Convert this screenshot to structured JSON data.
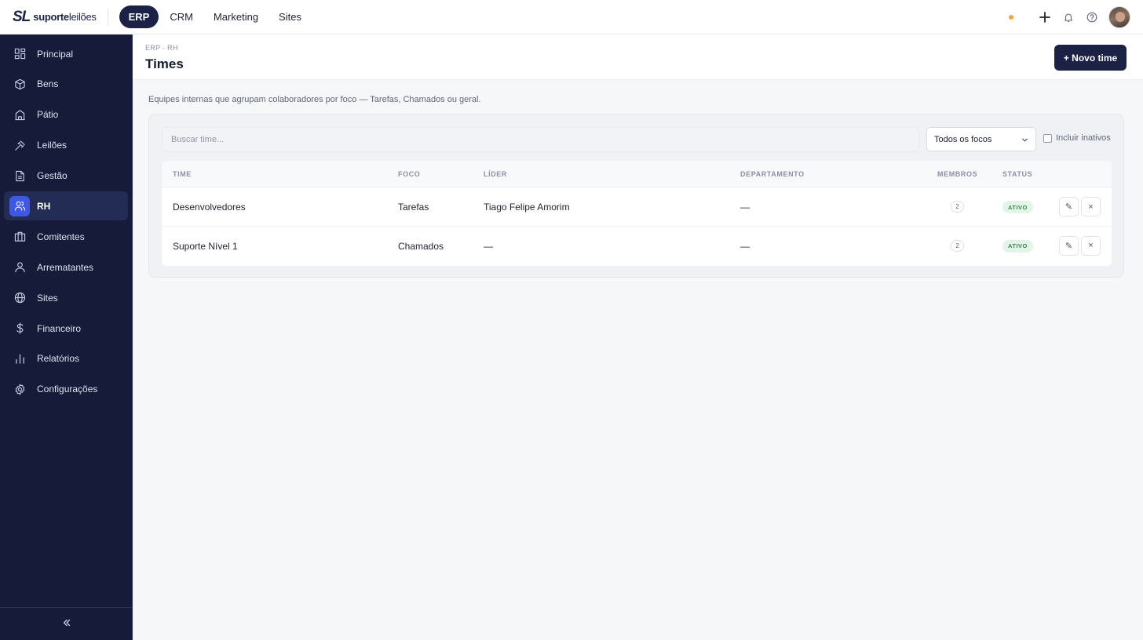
{
  "brand": {
    "mark": "SL",
    "name_bold": "suporte",
    "name_light": "leilões"
  },
  "topnav": [
    {
      "label": "ERP",
      "active": true
    },
    {
      "label": "CRM",
      "active": false
    },
    {
      "label": "Marketing",
      "active": false
    },
    {
      "label": "Sites",
      "active": false
    }
  ],
  "topbar_icons": [
    "status-dot",
    "plus-icon",
    "bell-icon",
    "help-icon",
    "user-avatar"
  ],
  "sidebar": {
    "items": [
      {
        "label": "Principal",
        "icon": "dashboard-icon"
      },
      {
        "label": "Bens",
        "icon": "box-icon"
      },
      {
        "label": "Pátio",
        "icon": "building-icon"
      },
      {
        "label": "Leilões",
        "icon": "gavel-icon"
      },
      {
        "label": "Gestão",
        "icon": "document-icon"
      },
      {
        "label": "RH",
        "icon": "users-icon",
        "active": true
      },
      {
        "label": "Comitentes",
        "icon": "briefcase-icon"
      },
      {
        "label": "Arrematantes",
        "icon": "user-icon"
      },
      {
        "label": "Sites",
        "icon": "globe-icon"
      },
      {
        "label": "Financeiro",
        "icon": "dollar-icon"
      },
      {
        "label": "Relatórios",
        "icon": "bar-chart-icon"
      },
      {
        "label": "Configurações",
        "icon": "gear-icon"
      }
    ],
    "collapse_icon": "double-chevron-left-icon"
  },
  "header": {
    "breadcrumb": "ERP · RH",
    "title": "Times",
    "new_button": "+ Novo time"
  },
  "subtitle": "Equipes internas que agrupam colaboradores por foco — Tarefas, Chamados ou geral.",
  "filters": {
    "search_placeholder": "Buscar time...",
    "focus_select": "Todos os focos",
    "include_inactive": "Incluir inativos"
  },
  "table": {
    "columns": [
      "TIME",
      "FOCO",
      "LÍDER",
      "DEPARTAMENTO",
      "MEMBROS",
      "STATUS"
    ],
    "rows": [
      {
        "time": "Desenvolvedores",
        "foco": "Tarefas",
        "lider": "Tiago Felipe Amorim",
        "departamento": "—",
        "membros": "2",
        "status": "ATIVO"
      },
      {
        "time": "Suporte Nível 1",
        "foco": "Chamados",
        "lider": "—",
        "departamento": "—",
        "membros": "2",
        "status": "ATIVO"
      }
    ],
    "edit_icon": "✎",
    "delete_icon": "×"
  },
  "colors": {
    "primary": "#1b2246",
    "sidebar_bg": "#151b38",
    "active_icon": "#3e59e0",
    "status_green": "#2f8a4a",
    "dot_orange": "#f0a43c"
  }
}
